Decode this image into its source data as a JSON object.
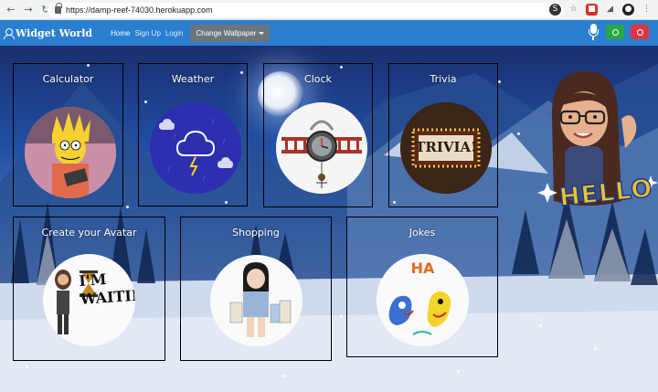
{
  "browser": {
    "url": "https://damp-reef-74030.herokuapp.com"
  },
  "navbar": {
    "brand": "Widget World",
    "links": [
      {
        "label": "Home"
      },
      {
        "label": "Sign Up"
      },
      {
        "label": "Login"
      }
    ],
    "wallpaper_button": "Change Wallpaper"
  },
  "widgets": [
    {
      "title": "Calculator"
    },
    {
      "title": "Weather"
    },
    {
      "title": "Clock"
    },
    {
      "title": "Trivia",
      "image_text": "TRIVIA!"
    },
    {
      "title": "Create your Avatar",
      "image_text": "I'M WAITING"
    },
    {
      "title": "Shopping"
    },
    {
      "title": "Jokes",
      "image_text": "HA"
    }
  ],
  "avatar": {
    "greeting": "HELLO"
  },
  "colors": {
    "navbar": "#2b7fd0",
    "wallpaper_button": "#6c757d",
    "record_start": "#28a745",
    "record_stop": "#dc3545"
  }
}
